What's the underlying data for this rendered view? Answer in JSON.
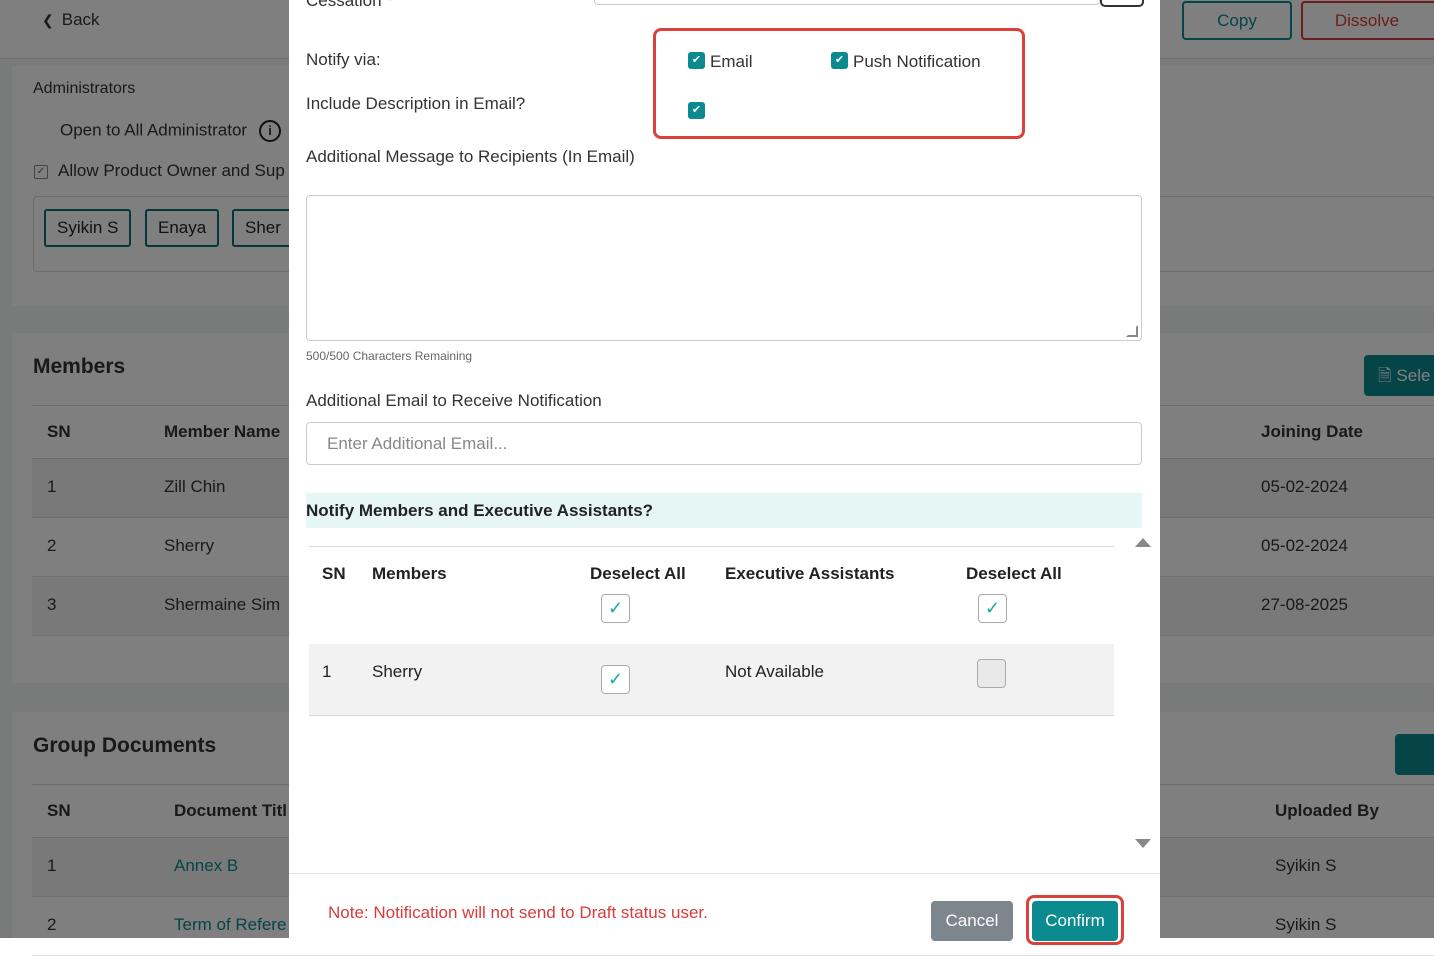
{
  "background": {
    "back_label": "Back",
    "copy_label": "Copy",
    "dissolve_label": "Dissolve",
    "admin": {
      "title": "Administrators",
      "open_label": "Open to All Administrator",
      "allow_label": "Allow Product Owner and Sup",
      "chips": [
        "Syikin S",
        "Enaya",
        "Sher"
      ]
    },
    "members": {
      "title": "Members",
      "select_label": "Sele",
      "headers": [
        "SN",
        "Member Name",
        "Joining Date"
      ],
      "rows": [
        {
          "sn": "1",
          "name": "Zill Chin",
          "date": "05-02-2024"
        },
        {
          "sn": "2",
          "name": "Sherry",
          "date": "05-02-2024"
        },
        {
          "sn": "3",
          "name": "Shermaine Sim",
          "date": "27-08-2025"
        }
      ]
    },
    "documents": {
      "title": "Group Documents",
      "headers": [
        "SN",
        "Document Titl",
        "Uploaded By"
      ],
      "rows": [
        {
          "sn": "1",
          "title": "Annex B",
          "by": "Syikin S"
        },
        {
          "sn": "2",
          "title": "Term of Refere",
          "by": "Syikin S"
        }
      ]
    }
  },
  "modal": {
    "cessation_label": "Cessation",
    "required_mark": "*",
    "notify_via_label": "Notify via:",
    "email_label": "Email",
    "push_label": "Push Notification",
    "include_desc_label": "Include Description in Email?",
    "additional_message_label": "Additional Message to Recipients (In Email)",
    "chars_remaining": "500/500 Characters Remaining",
    "additional_email_label": "Additional Email to Receive Notification",
    "additional_email_placeholder": "Enter Additional Email...",
    "notify_members_heading": "Notify Members and Executive Assistants?",
    "table": {
      "sn_header": "SN",
      "members_header": "Members",
      "deselect_all_members": "Deselect All",
      "ea_header": "Executive Assistants",
      "deselect_all_ea": "Deselect All",
      "rows": [
        {
          "sn": "1",
          "member": "Sherry",
          "member_checked": true,
          "ea": "Not Available",
          "ea_checked": false
        }
      ]
    },
    "note": "Note: Notification will not send to Draft status user.",
    "cancel_label": "Cancel",
    "confirm_label": "Confirm"
  },
  "colors": {
    "accent": "#0b8a8f",
    "danger": "#d93b3b",
    "highlight_band": "#e5f6f4"
  }
}
